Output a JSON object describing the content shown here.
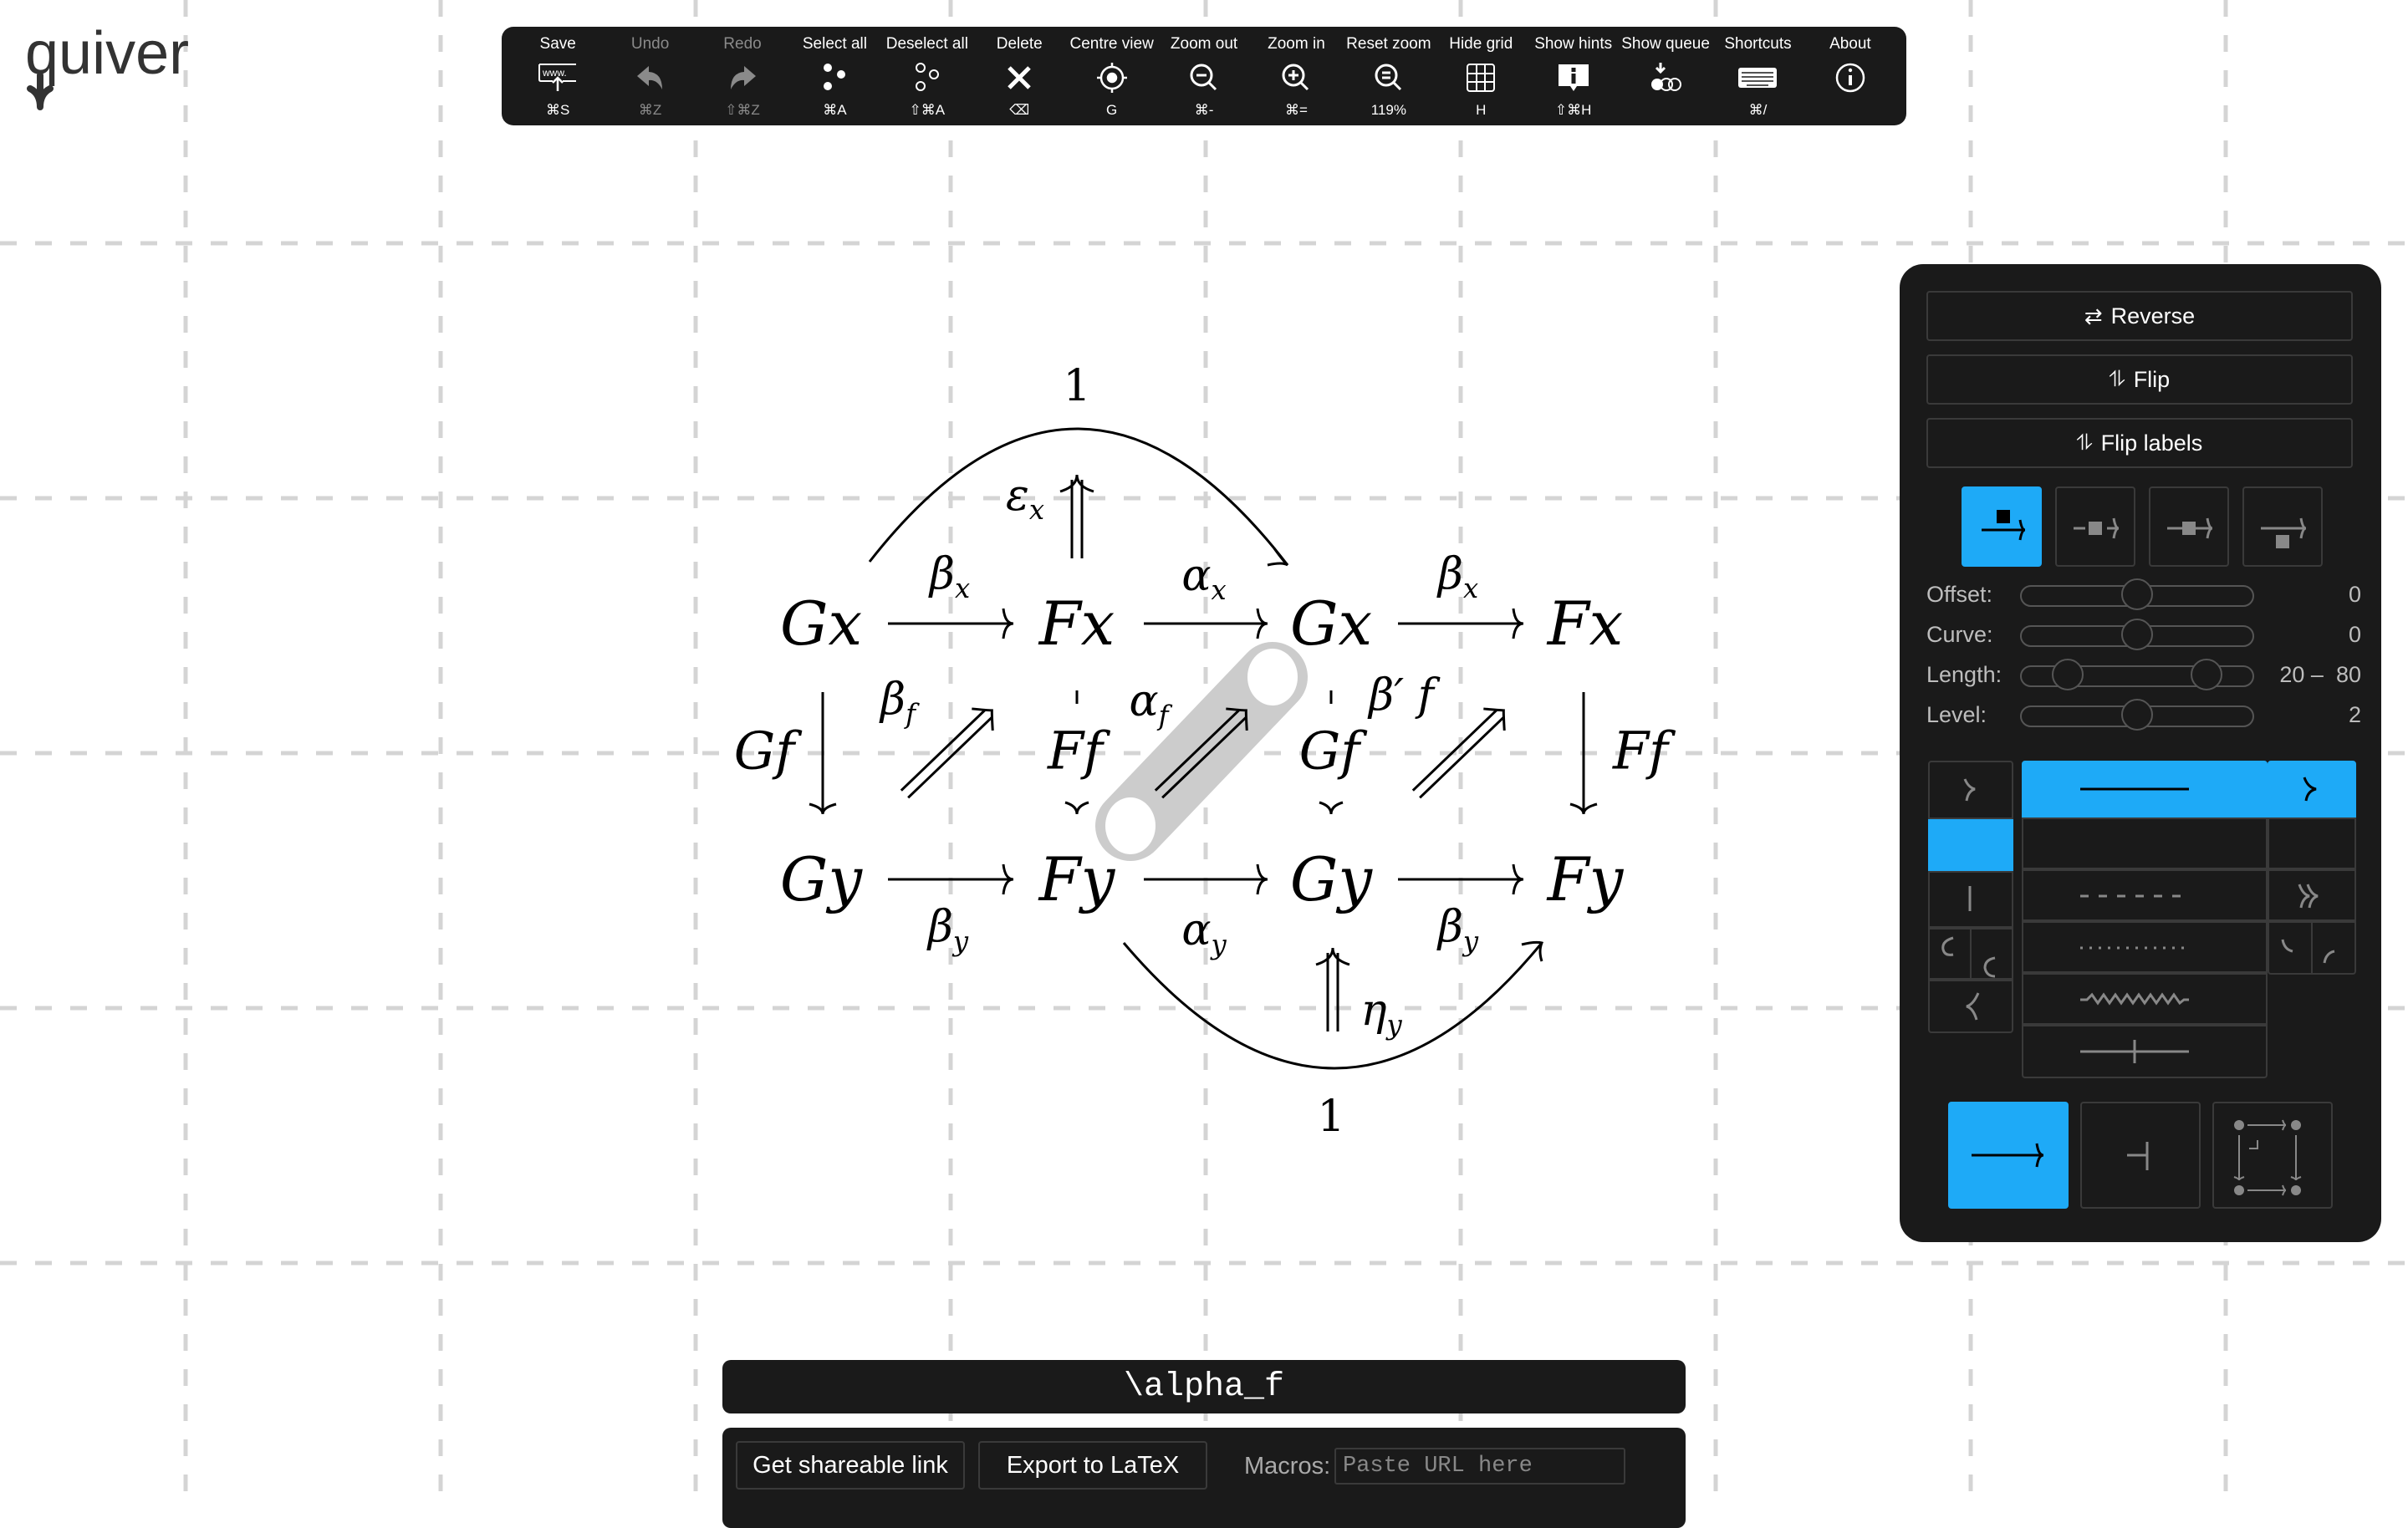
{
  "app": {
    "logo_text": "quiver"
  },
  "toolbar": {
    "buttons": [
      {
        "label": "Save",
        "shortcut": "⌘S",
        "icon": "save-url-icon",
        "enabled": true
      },
      {
        "label": "Undo",
        "shortcut": "⌘Z",
        "icon": "undo-icon",
        "enabled": false
      },
      {
        "label": "Redo",
        "shortcut": "⇧⌘Z",
        "icon": "redo-icon",
        "enabled": false
      },
      {
        "label": "Select all",
        "shortcut": "⌘A",
        "icon": "select-all-icon",
        "enabled": true
      },
      {
        "label": "Deselect all",
        "shortcut": "⇧⌘A",
        "icon": "deselect-all-icon",
        "enabled": true
      },
      {
        "label": "Delete",
        "shortcut": "⌫",
        "icon": "delete-icon",
        "enabled": true
      },
      {
        "label": "Centre view",
        "shortcut": "G",
        "icon": "centre-view-icon",
        "enabled": true
      },
      {
        "label": "Zoom out",
        "shortcut": "⌘-",
        "icon": "zoom-out-icon",
        "enabled": true
      },
      {
        "label": "Zoom in",
        "shortcut": "⌘=",
        "icon": "zoom-in-icon",
        "enabled": true
      },
      {
        "label": "Reset zoom",
        "shortcut": "119%",
        "icon": "reset-zoom-icon",
        "enabled": true
      },
      {
        "label": "Hide grid",
        "shortcut": "H",
        "icon": "grid-icon",
        "enabled": true
      },
      {
        "label": "Show hints",
        "shortcut": "⇧⌘H",
        "icon": "hint-icon",
        "enabled": true
      },
      {
        "label": "Show queue",
        "shortcut": "",
        "icon": "queue-icon",
        "enabled": true
      },
      {
        "label": "Shortcuts",
        "shortcut": "⌘/",
        "icon": "keyboard-icon",
        "enabled": true
      },
      {
        "label": "About",
        "shortcut": "",
        "icon": "info-icon",
        "enabled": true
      }
    ],
    "zoom_level": "119%"
  },
  "diagram": {
    "objects": [
      {
        "id": "gx1",
        "text": "Gx"
      },
      {
        "id": "fx1",
        "text": "Fx"
      },
      {
        "id": "gx2",
        "text": "Gx"
      },
      {
        "id": "fx2",
        "text": "Fx"
      },
      {
        "id": "gy1",
        "text": "Gy"
      },
      {
        "id": "fy1",
        "text": "Fy"
      },
      {
        "id": "gy2",
        "text": "Gy"
      },
      {
        "id": "fy2",
        "text": "Fy"
      }
    ],
    "labels": {
      "top_one": "1",
      "bottom_one": "1",
      "beta_x_1": {
        "base": "β",
        "sub": "x"
      },
      "alpha_x": {
        "base": "α",
        "sub": "x"
      },
      "beta_x_2": {
        "base": "β",
        "sub": "x"
      },
      "epsilon_x": {
        "base": "ε",
        "sub": "x"
      },
      "gf_1": "Gf",
      "beta_f": {
        "base": "β",
        "sub": "f"
      },
      "ff_1": "Ff",
      "alpha_f": {
        "base": "α",
        "sub": "f"
      },
      "gf_2": "Gf",
      "beta_prime_f": "β′ f",
      "ff_2": "Ff",
      "beta_y_1": {
        "base": "β",
        "sub": "y"
      },
      "alpha_y": {
        "base": "α",
        "sub": "y"
      },
      "beta_y_2": {
        "base": "β",
        "sub": "y"
      },
      "eta_y": {
        "base": "η",
        "sub": "y"
      }
    },
    "selected_edge": "alpha_f"
  },
  "panel": {
    "reverse_label": "Reverse",
    "flip_label": "Flip",
    "flip_labels_label": "Flip labels",
    "label_positions": [
      "left",
      "centre",
      "over",
      "right"
    ],
    "selected_label_position": "left",
    "sliders": [
      {
        "label": "Offset:",
        "value": "0",
        "fraction": 0.5
      },
      {
        "label": "Curve:",
        "value": "0",
        "fraction": 0.5
      },
      {
        "label": "Length:",
        "value_low": "20",
        "value_high": "80",
        "separator": "–",
        "low_fraction": 0.2,
        "high_fraction": 0.8
      },
      {
        "label": "Level:",
        "value": "2",
        "fraction": 0.5
      }
    ],
    "tail_styles": [
      "arrowhead",
      "none",
      "maps-to",
      "hook-top",
      "hook-bottom",
      "arrowhead-reverse"
    ],
    "selected_tail": "none",
    "body_styles": [
      "solid",
      "none",
      "dashed",
      "dotted",
      "squiggly",
      "barred"
    ],
    "selected_body": "solid",
    "head_styles": [
      "arrowhead",
      "none",
      "epi",
      "harpoon-top",
      "harpoon-bottom"
    ],
    "selected_head": "arrowhead",
    "edge_types": [
      "arrow",
      "adjunction",
      "pullback"
    ],
    "selected_edge_type": "arrow"
  },
  "label_input": {
    "value": "\\alpha_f"
  },
  "export": {
    "share_label": "Get shareable link",
    "latex_label": "Export to LaTeX",
    "macros_label": "Macros:",
    "macros_placeholder": "Paste URL here"
  },
  "colors": {
    "accent": "#1eaaf7",
    "panel_bg": "#1a1a1a",
    "grid": "#d4d4d4",
    "selection": "#cccccc"
  }
}
